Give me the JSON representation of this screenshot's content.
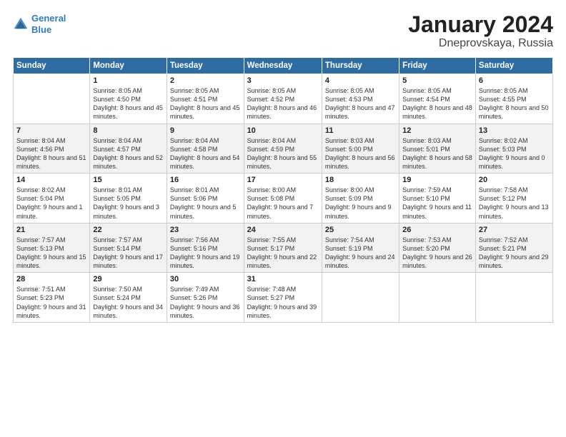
{
  "header": {
    "logo_line1": "General",
    "logo_line2": "Blue",
    "month": "January 2024",
    "location": "Dneprovskaya, Russia"
  },
  "weekdays": [
    "Sunday",
    "Monday",
    "Tuesday",
    "Wednesday",
    "Thursday",
    "Friday",
    "Saturday"
  ],
  "weeks": [
    [
      {
        "day": "",
        "sunrise": "",
        "sunset": "",
        "daylight": "",
        "empty": true
      },
      {
        "day": "1",
        "sunrise": "Sunrise: 8:05 AM",
        "sunset": "Sunset: 4:50 PM",
        "daylight": "Daylight: 8 hours and 45 minutes."
      },
      {
        "day": "2",
        "sunrise": "Sunrise: 8:05 AM",
        "sunset": "Sunset: 4:51 PM",
        "daylight": "Daylight: 8 hours and 45 minutes."
      },
      {
        "day": "3",
        "sunrise": "Sunrise: 8:05 AM",
        "sunset": "Sunset: 4:52 PM",
        "daylight": "Daylight: 8 hours and 46 minutes."
      },
      {
        "day": "4",
        "sunrise": "Sunrise: 8:05 AM",
        "sunset": "Sunset: 4:53 PM",
        "daylight": "Daylight: 8 hours and 47 minutes."
      },
      {
        "day": "5",
        "sunrise": "Sunrise: 8:05 AM",
        "sunset": "Sunset: 4:54 PM",
        "daylight": "Daylight: 8 hours and 48 minutes."
      },
      {
        "day": "6",
        "sunrise": "Sunrise: 8:05 AM",
        "sunset": "Sunset: 4:55 PM",
        "daylight": "Daylight: 8 hours and 50 minutes."
      }
    ],
    [
      {
        "day": "7",
        "sunrise": "Sunrise: 8:04 AM",
        "sunset": "Sunset: 4:56 PM",
        "daylight": "Daylight: 8 hours and 51 minutes."
      },
      {
        "day": "8",
        "sunrise": "Sunrise: 8:04 AM",
        "sunset": "Sunset: 4:57 PM",
        "daylight": "Daylight: 8 hours and 52 minutes."
      },
      {
        "day": "9",
        "sunrise": "Sunrise: 8:04 AM",
        "sunset": "Sunset: 4:58 PM",
        "daylight": "Daylight: 8 hours and 54 minutes."
      },
      {
        "day": "10",
        "sunrise": "Sunrise: 8:04 AM",
        "sunset": "Sunset: 4:59 PM",
        "daylight": "Daylight: 8 hours and 55 minutes."
      },
      {
        "day": "11",
        "sunrise": "Sunrise: 8:03 AM",
        "sunset": "Sunset: 5:00 PM",
        "daylight": "Daylight: 8 hours and 56 minutes."
      },
      {
        "day": "12",
        "sunrise": "Sunrise: 8:03 AM",
        "sunset": "Sunset: 5:01 PM",
        "daylight": "Daylight: 8 hours and 58 minutes."
      },
      {
        "day": "13",
        "sunrise": "Sunrise: 8:02 AM",
        "sunset": "Sunset: 5:03 PM",
        "daylight": "Daylight: 9 hours and 0 minutes."
      }
    ],
    [
      {
        "day": "14",
        "sunrise": "Sunrise: 8:02 AM",
        "sunset": "Sunset: 5:04 PM",
        "daylight": "Daylight: 9 hours and 1 minute."
      },
      {
        "day": "15",
        "sunrise": "Sunrise: 8:01 AM",
        "sunset": "Sunset: 5:05 PM",
        "daylight": "Daylight: 9 hours and 3 minutes."
      },
      {
        "day": "16",
        "sunrise": "Sunrise: 8:01 AM",
        "sunset": "Sunset: 5:06 PM",
        "daylight": "Daylight: 9 hours and 5 minutes."
      },
      {
        "day": "17",
        "sunrise": "Sunrise: 8:00 AM",
        "sunset": "Sunset: 5:08 PM",
        "daylight": "Daylight: 9 hours and 7 minutes."
      },
      {
        "day": "18",
        "sunrise": "Sunrise: 8:00 AM",
        "sunset": "Sunset: 5:09 PM",
        "daylight": "Daylight: 9 hours and 9 minutes."
      },
      {
        "day": "19",
        "sunrise": "Sunrise: 7:59 AM",
        "sunset": "Sunset: 5:10 PM",
        "daylight": "Daylight: 9 hours and 11 minutes."
      },
      {
        "day": "20",
        "sunrise": "Sunrise: 7:58 AM",
        "sunset": "Sunset: 5:12 PM",
        "daylight": "Daylight: 9 hours and 13 minutes."
      }
    ],
    [
      {
        "day": "21",
        "sunrise": "Sunrise: 7:57 AM",
        "sunset": "Sunset: 5:13 PM",
        "daylight": "Daylight: 9 hours and 15 minutes."
      },
      {
        "day": "22",
        "sunrise": "Sunrise: 7:57 AM",
        "sunset": "Sunset: 5:14 PM",
        "daylight": "Daylight: 9 hours and 17 minutes."
      },
      {
        "day": "23",
        "sunrise": "Sunrise: 7:56 AM",
        "sunset": "Sunset: 5:16 PM",
        "daylight": "Daylight: 9 hours and 19 minutes."
      },
      {
        "day": "24",
        "sunrise": "Sunrise: 7:55 AM",
        "sunset": "Sunset: 5:17 PM",
        "daylight": "Daylight: 9 hours and 22 minutes."
      },
      {
        "day": "25",
        "sunrise": "Sunrise: 7:54 AM",
        "sunset": "Sunset: 5:19 PM",
        "daylight": "Daylight: 9 hours and 24 minutes."
      },
      {
        "day": "26",
        "sunrise": "Sunrise: 7:53 AM",
        "sunset": "Sunset: 5:20 PM",
        "daylight": "Daylight: 9 hours and 26 minutes."
      },
      {
        "day": "27",
        "sunrise": "Sunrise: 7:52 AM",
        "sunset": "Sunset: 5:21 PM",
        "daylight": "Daylight: 9 hours and 29 minutes."
      }
    ],
    [
      {
        "day": "28",
        "sunrise": "Sunrise: 7:51 AM",
        "sunset": "Sunset: 5:23 PM",
        "daylight": "Daylight: 9 hours and 31 minutes."
      },
      {
        "day": "29",
        "sunrise": "Sunrise: 7:50 AM",
        "sunset": "Sunset: 5:24 PM",
        "daylight": "Daylight: 9 hours and 34 minutes."
      },
      {
        "day": "30",
        "sunrise": "Sunrise: 7:49 AM",
        "sunset": "Sunset: 5:26 PM",
        "daylight": "Daylight: 9 hours and 36 minutes."
      },
      {
        "day": "31",
        "sunrise": "Sunrise: 7:48 AM",
        "sunset": "Sunset: 5:27 PM",
        "daylight": "Daylight: 9 hours and 39 minutes."
      },
      {
        "day": "",
        "sunrise": "",
        "sunset": "",
        "daylight": "",
        "empty": true
      },
      {
        "day": "",
        "sunrise": "",
        "sunset": "",
        "daylight": "",
        "empty": true
      },
      {
        "day": "",
        "sunrise": "",
        "sunset": "",
        "daylight": "",
        "empty": true
      }
    ]
  ]
}
